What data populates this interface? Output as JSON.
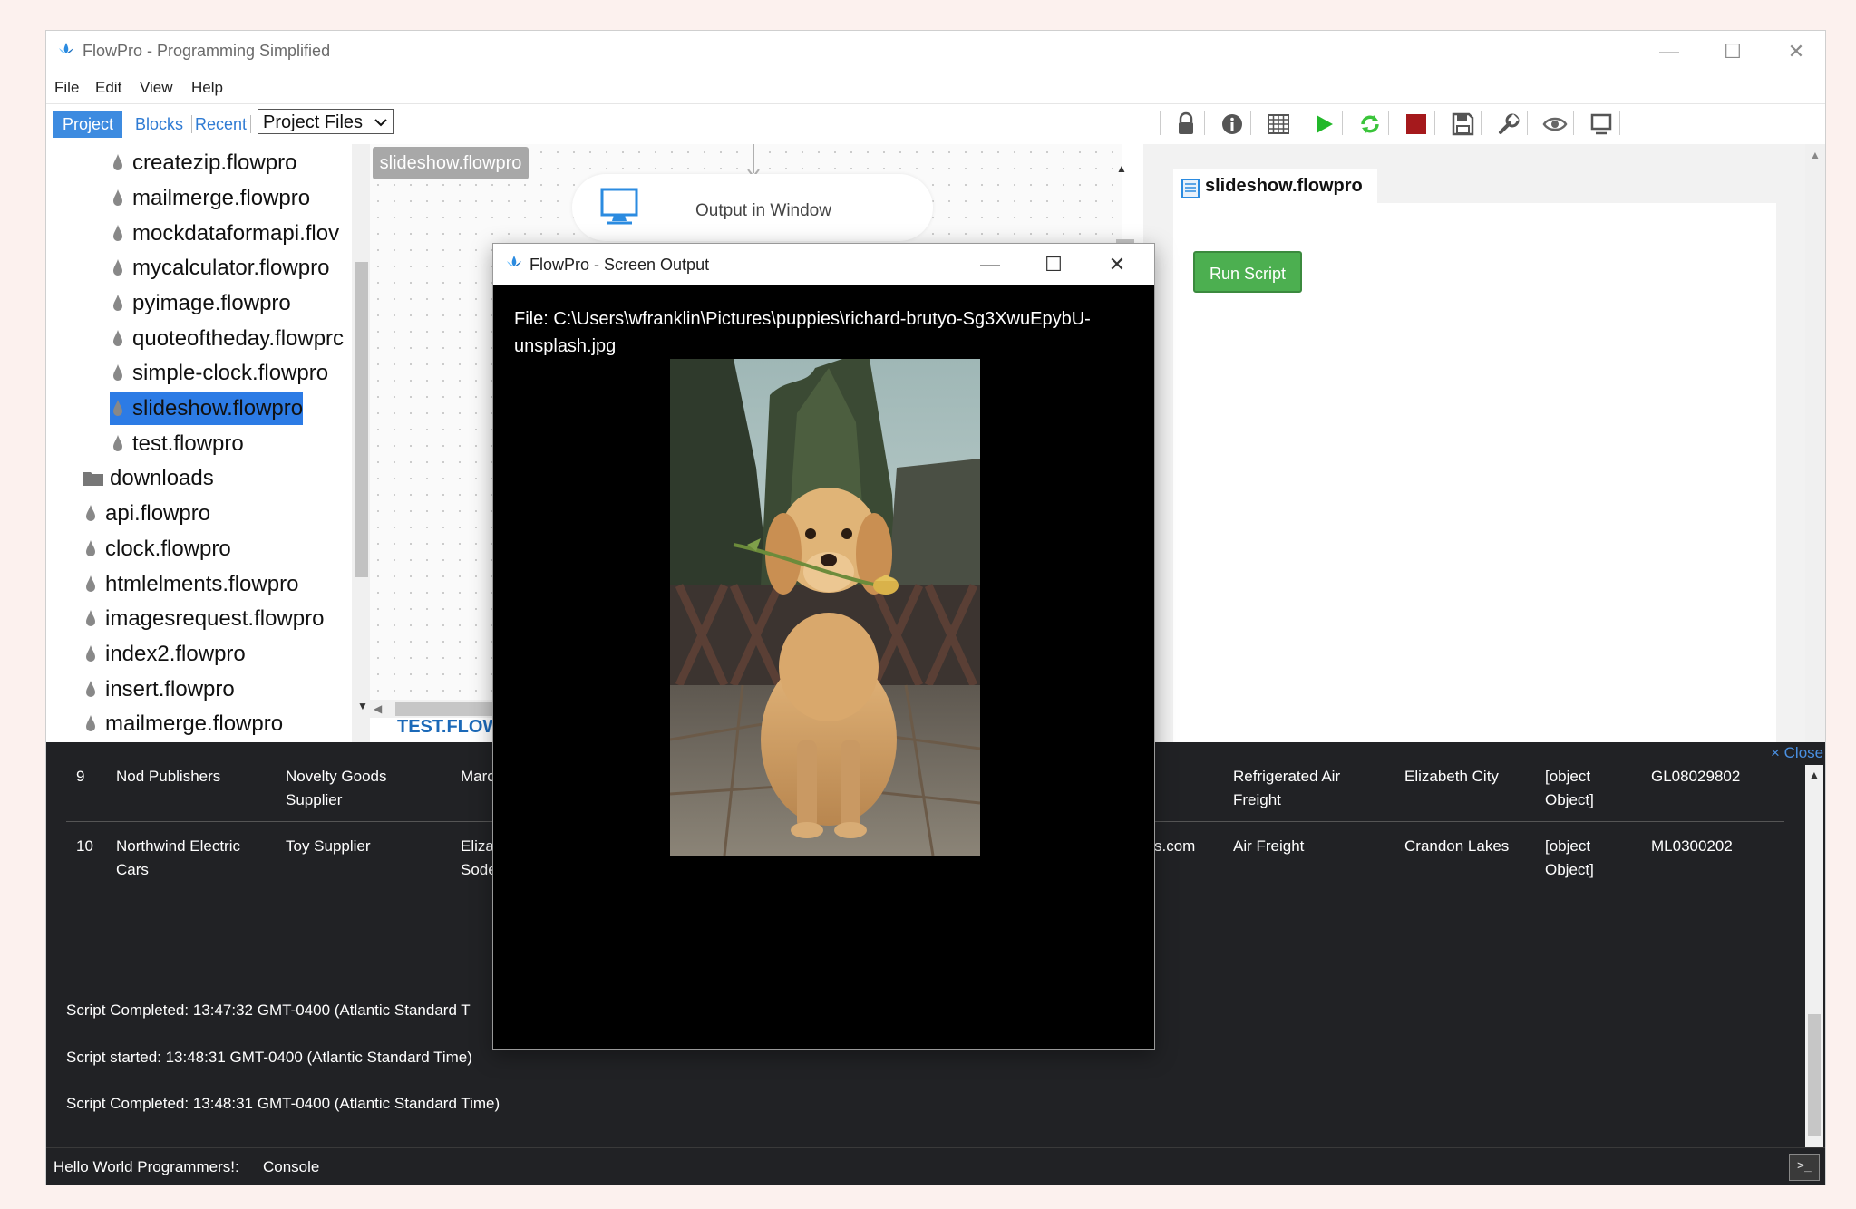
{
  "window": {
    "title": "FlowPro - Programming Simplified",
    "controls": {
      "minimize": "—",
      "maximize": "☐",
      "close": "✕"
    }
  },
  "menu": [
    "File",
    "Edit",
    "View",
    "Help"
  ],
  "toolbar": {
    "tabs": {
      "project": "Project",
      "blocks": "Blocks",
      "recent": "Recent"
    },
    "select_value": "Project Files",
    "icons": [
      "lock-icon",
      "info-icon",
      "grid-icon",
      "play-icon",
      "refresh-icon",
      "stop-icon",
      "save-icon",
      "tools-icon",
      "eye-icon",
      "monitor-icon"
    ]
  },
  "file_tree": {
    "items": [
      "createzip.flowpro",
      "mailmerge.flowpro",
      "mockdataformapi.flov",
      "mycalculator.flowpro",
      "pyimage.flowpro",
      "quoteoftheday.flowprc",
      "simple-clock.flowpro",
      "slideshow.flowpro",
      "test.flowpro",
      "downloads",
      "api.flowpro",
      "clock.flowpro",
      "htmlelments.flowpro",
      "imagesrequest.flowpro",
      "index2.flowpro",
      "insert.flowpro",
      "mailmerge.flowpro"
    ],
    "selected": "slideshow.flowpro"
  },
  "canvas": {
    "tab": "slideshow.flowpro",
    "node_label": "Output in Window",
    "bottom_tab": "TEST.FLOWI"
  },
  "script_panel": {
    "title": "slideshow.flowpro",
    "run_button": "Run Script"
  },
  "console": {
    "close_link": "× Close",
    "rows": [
      {
        "id": "9",
        "company": [
          "Nod Publishers"
        ],
        "type": [
          "Novelty Goods",
          "Supplier"
        ],
        "contact": [
          "Marc"
        ],
        "email": [],
        "shipping": [
          "Refrigerated Air",
          "Freight"
        ],
        "city": [
          "Elizabeth City"
        ],
        "obj": [
          "[object",
          "Object]"
        ],
        "code": "GL08029802"
      },
      {
        "id": "10",
        "company": [
          "Northwind Electric",
          "Cars"
        ],
        "type": [
          "Toy Supplier"
        ],
        "contact": [
          "Eliza",
          "Sode"
        ],
        "email": [
          "s.com"
        ],
        "shipping": [
          "Air Freight"
        ],
        "city": [
          "Crandon Lakes"
        ],
        "obj": [
          "[object",
          "Object]"
        ],
        "code": "ML0300202"
      }
    ],
    "logs": [
      "Script Completed: 13:47:32 GMT-0400 (Atlantic Standard T",
      "Script started: 13:48:31 GMT-0400 (Atlantic Standard Time)",
      "Script Completed: 13:48:31 GMT-0400 (Atlantic Standard Time)"
    ],
    "status": {
      "left": "Hello World Programmers!:",
      "right": "Console"
    }
  },
  "popup": {
    "title": "FlowPro - Screen Output",
    "file_line1": "File: C:\\Users\\wfranklin\\Pictures\\puppies\\richard-brutyo-Sg3XwuEpybU-",
    "file_line2": "unsplash.jpg",
    "controls": {
      "minimize": "—",
      "maximize": "☐",
      "close": "✕"
    }
  },
  "colors": {
    "accent_blue": "#2c7be5",
    "run_green": "#4caf50",
    "console_bg": "#212225",
    "popup_bg": "#000000"
  }
}
